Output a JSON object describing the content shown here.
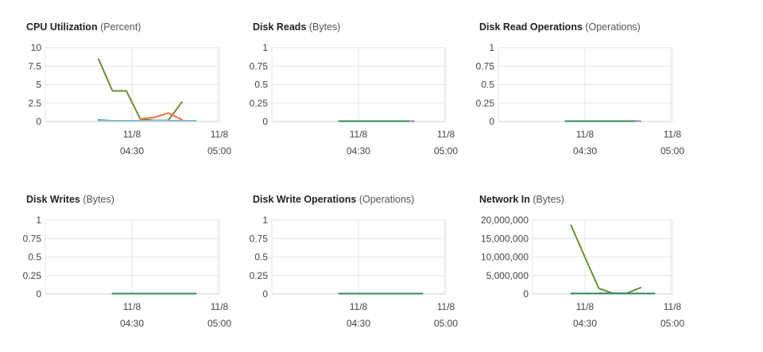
{
  "chart_data": [
    {
      "type": "line",
      "title": "CPU Utilization",
      "unit": "(Percent)",
      "yticks": [
        "10",
        "7.5",
        "5",
        "2.5",
        "0"
      ],
      "ylim": [
        0,
        10
      ],
      "xticks": [
        {
          "date": "11/8",
          "time": "04:30"
        },
        {
          "date": "11/8",
          "time": "05:00"
        }
      ],
      "grid": true,
      "series": [
        {
          "color": "#6b8e2f",
          "x": [
            "04:18",
            "04:23",
            "04:28",
            "04:33",
            "04:38",
            "04:43",
            "04:48"
          ],
          "y": [
            8.4,
            4.1,
            4.1,
            0.3,
            0.1,
            0.1,
            2.6
          ]
        },
        {
          "color": "#f07040",
          "x": [
            "04:33",
            "04:38",
            "04:43",
            "04:48"
          ],
          "y": [
            0.3,
            0.5,
            1.1,
            0.2
          ]
        },
        {
          "color": "#2e8b57",
          "x": [
            "04:18",
            "04:23",
            "04:28",
            "04:33",
            "04:38",
            "04:43",
            "04:48",
            "04:53"
          ],
          "y": [
            0.15,
            0.05,
            0.05,
            0.05,
            0.05,
            0.05,
            0.05,
            0.05
          ]
        },
        {
          "color": "#a87bc0",
          "x": [
            "04:33",
            "04:38",
            "04:43"
          ],
          "y": [
            0.05,
            0.05,
            0.05
          ]
        },
        {
          "color": "#9fc7d9",
          "x": [
            "04:18",
            "04:23",
            "04:28",
            "04:33",
            "04:38",
            "04:43",
            "04:48",
            "04:53"
          ],
          "y": [
            0.02,
            0.02,
            0.02,
            0.02,
            0.02,
            0.02,
            0.02,
            0.02
          ]
        }
      ]
    },
    {
      "type": "line",
      "title": "Disk Reads",
      "unit": "(Bytes)",
      "yticks": [
        "1",
        "0.75",
        "0.5",
        "0.25",
        "0"
      ],
      "ylim": [
        0,
        1
      ],
      "xticks": [
        {
          "date": "11/8",
          "time": "04:30"
        },
        {
          "date": "11/8",
          "time": "05:00"
        }
      ],
      "grid": true,
      "series": [
        {
          "color": "#a87bc0",
          "x": [
            "04:35",
            "04:50"
          ],
          "y": [
            0,
            0
          ]
        },
        {
          "color": "#9fc7d9",
          "x": [
            "04:23",
            "04:48"
          ],
          "y": [
            0,
            0
          ]
        },
        {
          "color": "#2e8b57",
          "x": [
            "04:23",
            "04:48"
          ],
          "y": [
            0,
            0
          ]
        }
      ]
    },
    {
      "type": "line",
      "title": "Disk Read Operations",
      "unit": "(Operations)",
      "yticks": [
        "1",
        "0.75",
        "0.5",
        "0.25",
        "0"
      ],
      "ylim": [
        0,
        1
      ],
      "xticks": [
        {
          "date": "11/8",
          "time": "04:30"
        },
        {
          "date": "11/8",
          "time": "05:00"
        }
      ],
      "grid": true,
      "series": [
        {
          "color": "#a87bc0",
          "x": [
            "04:35",
            "04:50"
          ],
          "y": [
            0,
            0
          ]
        },
        {
          "color": "#9fc7d9",
          "x": [
            "04:23",
            "04:48"
          ],
          "y": [
            0,
            0
          ]
        },
        {
          "color": "#2e8b57",
          "x": [
            "04:23",
            "04:48"
          ],
          "y": [
            0,
            0
          ]
        }
      ]
    },
    {
      "type": "line",
      "title": "Disk Writes",
      "unit": "(Bytes)",
      "yticks": [
        "1",
        "0.75",
        "0.5",
        "0.25",
        "0"
      ],
      "ylim": [
        0,
        1
      ],
      "xticks": [
        {
          "date": "11/8",
          "time": "04:30"
        },
        {
          "date": "11/8",
          "time": "05:00"
        }
      ],
      "grid": true,
      "series": [
        {
          "color": "#a87bc0",
          "x": [
            "04:35",
            "04:50"
          ],
          "y": [
            0,
            0
          ]
        },
        {
          "color": "#9fc7d9",
          "x": [
            "04:23",
            "04:48"
          ],
          "y": [
            0,
            0
          ]
        },
        {
          "color": "#2e8b57",
          "x": [
            "04:23",
            "04:53"
          ],
          "y": [
            0,
            0
          ]
        }
      ]
    },
    {
      "type": "line",
      "title": "Disk Write Operations",
      "unit": "(Operations)",
      "yticks": [
        "1",
        "0.75",
        "0.5",
        "0.25",
        "0"
      ],
      "ylim": [
        0,
        1
      ],
      "xticks": [
        {
          "date": "11/8",
          "time": "04:30"
        },
        {
          "date": "11/8",
          "time": "05:00"
        }
      ],
      "grid": true,
      "series": [
        {
          "color": "#a87bc0",
          "x": [
            "04:35",
            "04:50"
          ],
          "y": [
            0,
            0
          ]
        },
        {
          "color": "#9fc7d9",
          "x": [
            "04:23",
            "04:48"
          ],
          "y": [
            0,
            0
          ]
        },
        {
          "color": "#2e8b57",
          "x": [
            "04:23",
            "04:53"
          ],
          "y": [
            0,
            0
          ]
        }
      ]
    },
    {
      "type": "line",
      "title": "Network In",
      "unit": "(Bytes)",
      "yticks": [
        "20,000,000",
        "15,000,000",
        "10,000,000",
        "5,000,000",
        "0"
      ],
      "ylim": [
        0,
        20000000
      ],
      "xticks": [
        {
          "date": "11/8",
          "time": "04:30"
        },
        {
          "date": "11/8",
          "time": "05:00"
        }
      ],
      "grid": true,
      "series": [
        {
          "color": "#6b8e2f",
          "x": [
            "04:25",
            "04:30",
            "04:35",
            "04:40",
            "04:45",
            "04:50"
          ],
          "y": [
            18500000,
            9800000,
            1400000,
            100000,
            100000,
            1600000
          ]
        },
        {
          "color": "#a87bc0",
          "x": [
            "04:35",
            "04:45"
          ],
          "y": [
            50000,
            50000
          ]
        },
        {
          "color": "#9fc7d9",
          "x": [
            "04:25",
            "04:55"
          ],
          "y": [
            20000,
            20000
          ]
        },
        {
          "color": "#2e8b57",
          "x": [
            "04:25",
            "04:55"
          ],
          "y": [
            20000,
            20000
          ]
        }
      ]
    }
  ]
}
